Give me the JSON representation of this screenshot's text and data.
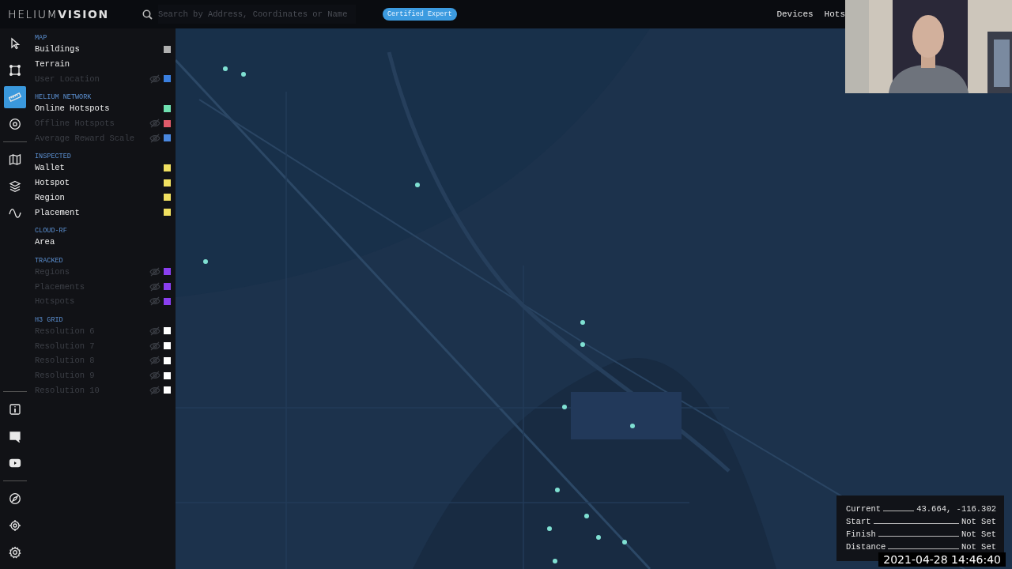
{
  "header": {
    "logo": "HELIUM**VISION**",
    "search": {
      "placeholder": "Search by Address, Coordinates or Name"
    },
    "badge": "Certified Expert",
    "nav": [
      {
        "label": "Devices"
      },
      {
        "label": "Hots"
      }
    ]
  },
  "rail": {
    "top": [
      [
        {
          "kind": "pointer",
          "selected": false
        },
        {
          "kind": "select-box",
          "selected": false
        },
        {
          "kind": "ruler",
          "selected": true
        },
        {
          "kind": "target",
          "selected": false
        }
      ],
      [
        {
          "kind": "map",
          "selected": false
        },
        {
          "kind": "layers",
          "selected": false
        },
        {
          "kind": "wave",
          "selected": false
        }
      ]
    ],
    "bottom": [
      [
        {
          "kind": "info",
          "selected": false
        },
        {
          "kind": "chat",
          "selected": false
        },
        {
          "kind": "video",
          "selected": false
        }
      ],
      [
        {
          "kind": "compass",
          "selected": false
        },
        {
          "kind": "crosshair",
          "selected": false
        },
        {
          "kind": "settings",
          "selected": false
        }
      ]
    ]
  },
  "layers": [
    {
      "title": "MAP",
      "items": [
        {
          "label": "Buildings",
          "on": true,
          "color": "#b0b0b0"
        },
        {
          "label": "Terrain",
          "on": true
        },
        {
          "label": "User Location",
          "on": false,
          "color": "#3a7fe0"
        }
      ]
    },
    {
      "title": "HELIUM NETWORK",
      "items": [
        {
          "label": "Online Hotspots",
          "on": true,
          "color": "#6fe0b0"
        },
        {
          "label": "Offline Hotspots",
          "on": false,
          "color": "#e05a6a"
        },
        {
          "label": "Average Reward Scale",
          "on": false,
          "color": "#4a88e0"
        }
      ]
    },
    {
      "title": "INSPECTED",
      "items": [
        {
          "label": "Wallet",
          "on": true,
          "color": "#f0e060"
        },
        {
          "label": "Hotspot",
          "on": true,
          "color": "#f0e060"
        },
        {
          "label": "Region",
          "on": true,
          "color": "#f0e060"
        },
        {
          "label": "Placement",
          "on": true,
          "color": "#f0e060"
        }
      ]
    },
    {
      "title": "CLOUD-RF",
      "items": [
        {
          "label": "Area",
          "on": true
        }
      ]
    },
    {
      "title": "TRACKED",
      "items": [
        {
          "label": "Regions",
          "on": false,
          "color": "#8a3ff0"
        },
        {
          "label": "Placements",
          "on": false,
          "color": "#8a3ff0"
        },
        {
          "label": "Hotspots",
          "on": false,
          "color": "#8a3ff0"
        }
      ]
    },
    {
      "title": "H3 GRID",
      "items": [
        {
          "label": "Resolution 6",
          "on": false,
          "color": "#ffffff"
        },
        {
          "label": "Resolution 7",
          "on": false,
          "color": "#ffffff"
        },
        {
          "label": "Resolution 8",
          "on": false,
          "color": "#ffffff"
        },
        {
          "label": "Resolution 9",
          "on": false,
          "color": "#ffffff"
        },
        {
          "label": "Resolution 10",
          "on": false,
          "color": "#ffffff"
        }
      ]
    }
  ],
  "readout": [
    {
      "label": "Current",
      "value": "43.664, -116.302"
    },
    {
      "label": "Start",
      "value": "Not Set"
    },
    {
      "label": "Finish",
      "value": "Not Set"
    },
    {
      "label": "Distance",
      "value": "Not Set"
    }
  ],
  "timestamp": "2021-04-28 14:46:40"
}
